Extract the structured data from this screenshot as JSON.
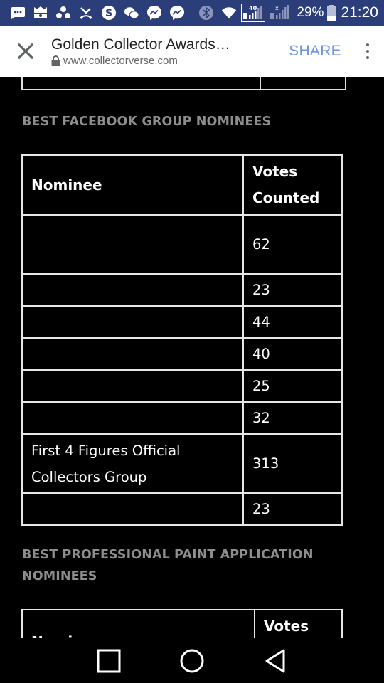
{
  "status_bar": {
    "icons": [
      "message-icon",
      "game-icon",
      "dots-icon",
      "missed-call-icon",
      "skype-icon",
      "wechat-icon",
      "messenger-icon",
      "messenger-icon",
      "bluetooth-icon",
      "wifi-icon",
      "signal-sim1-icon",
      "signal-sim2-icon"
    ],
    "sim1_label": "40",
    "battery": "29%",
    "time": "21:20"
  },
  "toolbar": {
    "title": "Golden Collector Awards…",
    "url": "www.collectorverse.com",
    "share_label": "SHARE"
  },
  "sections": [
    {
      "heading": "BEST FACEBOOK GROUP NOMINEES",
      "columns": [
        "Nominee",
        "Votes Counted"
      ],
      "columns_display": {
        "nominee": "Nominee",
        "votes_line1": "Votes",
        "votes_line2": "Counted"
      },
      "rows": [
        {
          "nominee": "",
          "votes": "62"
        },
        {
          "nominee": "",
          "votes": "23"
        },
        {
          "nominee": "",
          "votes": "44"
        },
        {
          "nominee": "",
          "votes": "40"
        },
        {
          "nominee": "",
          "votes": "25"
        },
        {
          "nominee": "",
          "votes": "32"
        },
        {
          "nominee": "First 4 Figures Official Collectors Group",
          "nominee_line1": "First 4 Figures Official",
          "nominee_line2": "Collectors Group",
          "votes": "313"
        },
        {
          "nominee": "",
          "votes": "23"
        }
      ]
    },
    {
      "heading_line1": "BEST PROFESSIONAL PAINT APPLICATION",
      "heading_line2": "NOMINEES",
      "columns": [
        "Nominee",
        "Votes"
      ]
    }
  ],
  "nav_bar": {
    "buttons": [
      "recents-icon",
      "home-icon",
      "back-icon"
    ]
  },
  "colors": {
    "status_bar_bg": "#2c3e7a",
    "toolbar_bg": "#ffffff",
    "share_accent": "#6f97d6",
    "page_bg": "#000000",
    "heading_gray": "#8d8d8d",
    "table_border": "#e6e6e6"
  }
}
